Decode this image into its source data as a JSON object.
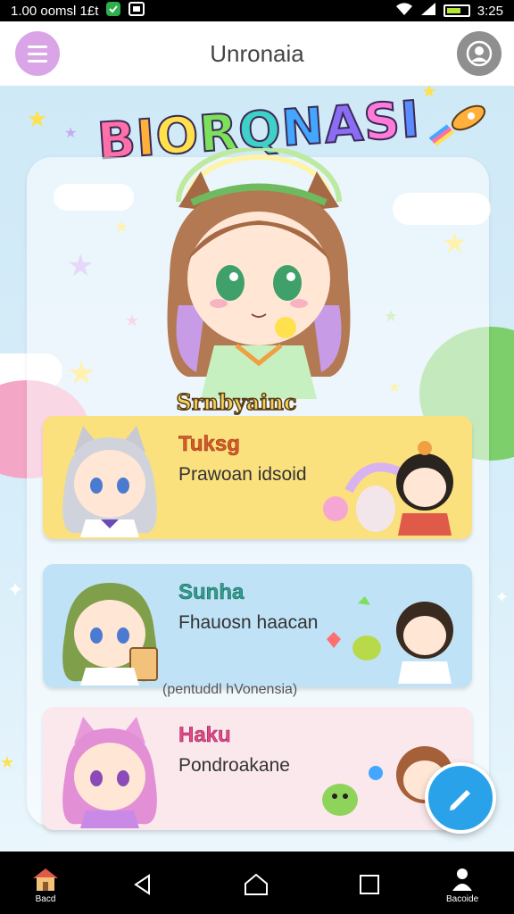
{
  "status_bar": {
    "time_left": "1.00 oomsl 1£t",
    "time_right": "3:25",
    "icons": [
      "shield-icon",
      "gallery-icon",
      "wifi-icon",
      "signal-icon",
      "battery-icon"
    ]
  },
  "header": {
    "title": "Unronaia",
    "menu_icon": "hamburger-icon",
    "profile_icon": "user-icon"
  },
  "logo": {
    "letters": [
      "B",
      "I",
      "O",
      "R",
      "Q",
      "N",
      "A",
      "S",
      "I"
    ],
    "colors": [
      "#ff6fa8",
      "#ffb03b",
      "#ffe14d",
      "#7be05a",
      "#3fd0c8",
      "#43a6ff",
      "#8b6cf5",
      "#ff7ad9",
      "#5b8cff"
    ]
  },
  "hero": {
    "subtitle": "Srnbyainc"
  },
  "cards": [
    {
      "name": "Tuksg",
      "description": "Prawoan idsoid",
      "bg": "#fbe07e",
      "name_color": "#d65a2a"
    },
    {
      "name": "Sunha",
      "description": "Fhauosn haacan",
      "bg": "#bfe2f6",
      "name_color": "#2f9e8f"
    },
    {
      "name": "Haku",
      "description": "Pondroakane",
      "bg": "#fbe8ec",
      "name_color": "#e04a88"
    }
  ],
  "caption": "(pentuddl hVonensia)",
  "fab": {
    "icon": "pencil-icon"
  },
  "nav": {
    "home_label": "Bacd",
    "profile_label": "Bacoide",
    "icons": [
      "home-icon",
      "back-icon",
      "circle-home-icon",
      "square-recent-icon",
      "user-icon"
    ]
  },
  "colors": {
    "accent": "#2aa2ea",
    "menu": "#d9a5e6",
    "status_bar": "#000000"
  }
}
